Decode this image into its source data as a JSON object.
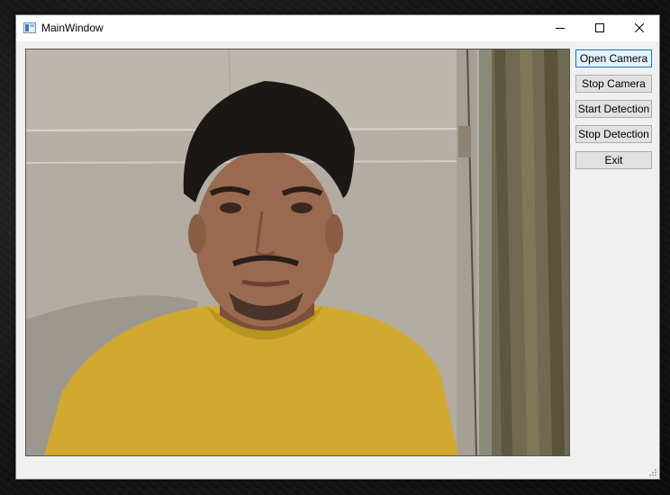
{
  "window": {
    "title": "MainWindow",
    "controls": {
      "minimize_icon": "minimize-icon",
      "maximize_icon": "maximize-icon",
      "close_icon": "close-icon"
    }
  },
  "buttons": [
    {
      "label": "Open Camera"
    },
    {
      "label": "Stop Camera"
    },
    {
      "label": "Start Detection"
    },
    {
      "label": "Stop Detection"
    },
    {
      "label": "Exit"
    }
  ],
  "colors": {
    "focus_border": "#0078d7",
    "shirt": "#d0a92e",
    "window_bg": "#f0f0f0"
  }
}
